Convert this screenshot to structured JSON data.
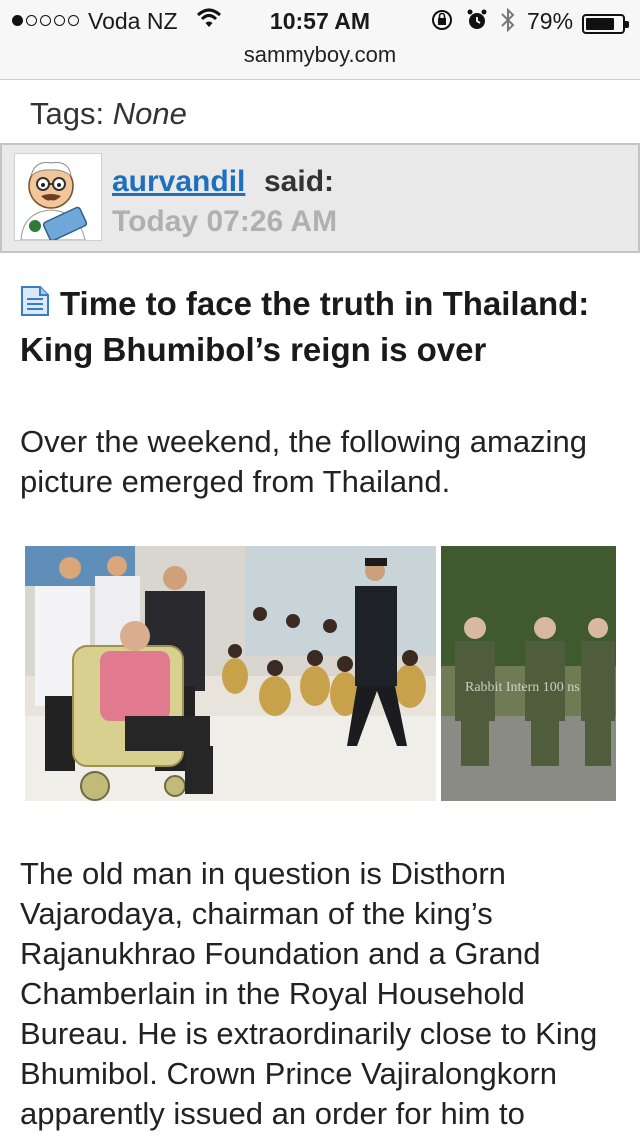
{
  "status_bar": {
    "carrier": "Voda NZ",
    "time": "10:57 AM",
    "battery_percent": "79%",
    "battery_level": 0.79,
    "signal_bars_on": 1,
    "signal_bars_total": 5,
    "icons": [
      "wifi-icon",
      "orientation-lock-icon",
      "alarm-icon",
      "bluetooth-icon",
      "battery-icon"
    ]
  },
  "browser": {
    "url": "sammyboy.com"
  },
  "tags": {
    "label": "Tags:",
    "value": "None"
  },
  "post": {
    "username": "aurvandil",
    "said_label": "said:",
    "date": "Today 07:26 AM",
    "avatar_icon": "doctor-avatar-icon"
  },
  "article": {
    "title": "Time to face the truth in Thailand: King Bhumibol’s reign is over",
    "intro": "Over the weekend, the following amazing picture emerged from Thailand.",
    "photo_watermark": "Rabbit Intern 100 ns",
    "body": "The old man in question is Disthorn Vajarodaya, chairman of the king’s Rajanukhrao Foundation and a Grand Chamberlain in the Royal Household Bureau. He is extraordinarily close to King Bhumibol. Crown Prince Vajiralongkorn apparently issued an order for him to"
  },
  "colors": {
    "link": "#1f6fbf",
    "muted": "#b0b0b0",
    "header_bg": "#e9e9e9"
  }
}
